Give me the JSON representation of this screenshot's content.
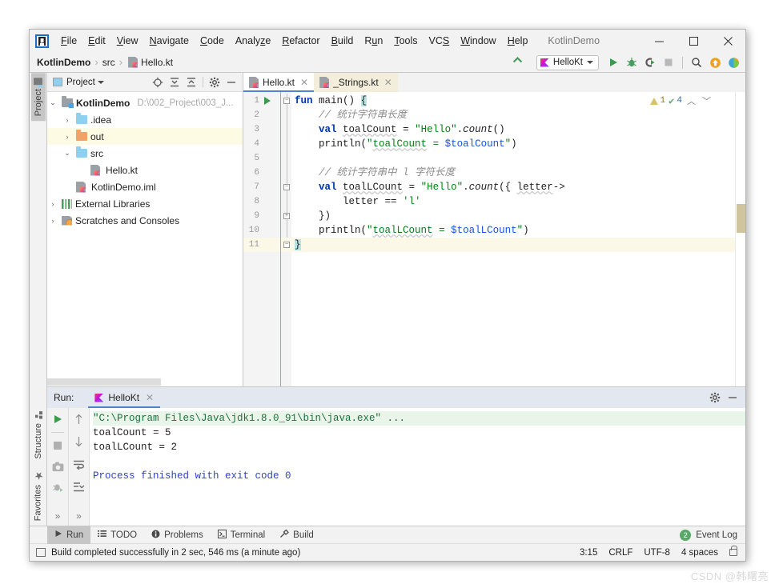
{
  "window": {
    "title": "KotlinDemo",
    "minimize_label": "–",
    "maximize_label": "□",
    "close_label": "✕"
  },
  "menubar": {
    "items": [
      {
        "label": "File",
        "mnemonic": "F"
      },
      {
        "label": "Edit",
        "mnemonic": "E"
      },
      {
        "label": "View",
        "mnemonic": "V"
      },
      {
        "label": "Navigate",
        "mnemonic": "N"
      },
      {
        "label": "Code",
        "mnemonic": "C"
      },
      {
        "label": "Analyze",
        "mnemonic": "z"
      },
      {
        "label": "Refactor",
        "mnemonic": "R"
      },
      {
        "label": "Build",
        "mnemonic": "B"
      },
      {
        "label": "Run",
        "mnemonic": "u"
      },
      {
        "label": "Tools",
        "mnemonic": "T"
      },
      {
        "label": "VCS",
        "mnemonic": "S"
      },
      {
        "label": "Window",
        "mnemonic": "W"
      },
      {
        "label": "Help",
        "mnemonic": "H"
      }
    ]
  },
  "navbar": {
    "breadcrumbs": [
      "KotlinDemo",
      "src",
      "Hello.kt"
    ],
    "separator": "›",
    "run_config": "HelloKt",
    "icons": [
      "back-arrow-icon",
      "run-icon",
      "debug-icon",
      "run-coverage-icon",
      "stop-icon",
      "search-everywhere-icon",
      "update-project-icon",
      "ide-assistant-icon"
    ]
  },
  "rails": {
    "left_top": "Project",
    "left_bottom_1": "Structure",
    "left_bottom_2": "Favorites"
  },
  "project_panel": {
    "title": "Project",
    "toolbar_icons": [
      "locate-icon",
      "expand-all-icon",
      "collapse-all-icon",
      "settings-icon",
      "hide-icon"
    ],
    "tree": [
      {
        "label": "KotlinDemo",
        "path": "D:\\002_Project\\003_J...",
        "icon": "module-folder-icon",
        "indent": 0,
        "arrow": "v",
        "bold": true,
        "highlight": false
      },
      {
        "label": ".idea",
        "path": "",
        "icon": "folder-icon",
        "indent": 1,
        "arrow": ">",
        "bold": false,
        "highlight": false
      },
      {
        "label": "out",
        "path": "",
        "icon": "folder-orange-icon",
        "indent": 1,
        "arrow": ">",
        "bold": false,
        "highlight": true
      },
      {
        "label": "src",
        "path": "",
        "icon": "folder-icon",
        "indent": 1,
        "arrow": "v",
        "bold": false,
        "highlight": false
      },
      {
        "label": "Hello.kt",
        "path": "",
        "icon": "kotlin-file-icon",
        "indent": 2,
        "arrow": "",
        "bold": false,
        "highlight": false
      },
      {
        "label": "KotlinDemo.iml",
        "path": "",
        "icon": "iml-file-icon",
        "indent": 1,
        "arrow": "",
        "bold": false,
        "highlight": false
      },
      {
        "label": "External Libraries",
        "path": "",
        "icon": "libraries-icon",
        "indent": 0,
        "arrow": ">",
        "bold": false,
        "highlight": false
      },
      {
        "label": "Scratches and Consoles",
        "path": "",
        "icon": "scratches-icon",
        "indent": 0,
        "arrow": ">",
        "bold": false,
        "highlight": false
      }
    ]
  },
  "editor": {
    "tabs": [
      {
        "label": "Hello.kt",
        "active": true,
        "library": false,
        "close": "✕"
      },
      {
        "label": "_Strings.kt",
        "active": false,
        "library": true,
        "close": "✕"
      }
    ],
    "inspections": {
      "warning_count": "1",
      "ok_count": "4",
      "prev_label": "︿",
      "next_label": "﹀"
    },
    "line_numbers": [
      "1",
      "2",
      "3",
      "4",
      "5",
      "6",
      "7",
      "8",
      "9",
      "10",
      "11"
    ],
    "current_line": 11,
    "code_lines": [
      {
        "n": 1,
        "text": "fun main() {"
      },
      {
        "n": 2,
        "text": "    // 统计字符串长度"
      },
      {
        "n": 3,
        "text": "    val toalCount = \"Hello\".count()"
      },
      {
        "n": 4,
        "text": "    println(\"toalCount = $toalCount\")"
      },
      {
        "n": 5,
        "text": ""
      },
      {
        "n": 6,
        "text": "    // 统计字符串中 l 字符长度"
      },
      {
        "n": 7,
        "text": "    val toalLCount = \"Hello\".count({ letter->"
      },
      {
        "n": 8,
        "text": "        letter == 'l'"
      },
      {
        "n": 9,
        "text": "    })"
      },
      {
        "n": 10,
        "text": "    println(\"toalLCount = $toalLCount\")"
      },
      {
        "n": 11,
        "text": "}"
      }
    ]
  },
  "run_panel": {
    "label": "Run:",
    "tab": "HelloKt",
    "tab_close": "✕",
    "toolbar_left": [
      "rerun-icon",
      "stop-icon",
      "screenshot-icon",
      "dump-threads-icon",
      "more-icon"
    ],
    "toolbar_right": [
      "up-arrow-icon",
      "down-arrow-icon",
      "soft-wrap-icon",
      "scroll-to-end-icon",
      "more-icon"
    ],
    "header_icons": [
      "settings-icon",
      "hide-icon"
    ],
    "console": [
      {
        "text": "\"C:\\Program Files\\Java\\jdk1.8.0_91\\bin\\java.exe\" ...",
        "style": "cmd"
      },
      {
        "text": "toalCount = 5",
        "style": "out"
      },
      {
        "text": "toalLCount = 2",
        "style": "out"
      },
      {
        "text": "",
        "style": "out"
      },
      {
        "text": "Process finished with exit code 0",
        "style": "end"
      }
    ]
  },
  "toolwindow_bar": {
    "items": [
      {
        "label": "Run",
        "icon": "run-icon",
        "active": true
      },
      {
        "label": "TODO",
        "icon": "todo-icon",
        "active": false
      },
      {
        "label": "Problems",
        "icon": "problems-icon",
        "active": false
      },
      {
        "label": "Terminal",
        "icon": "terminal-icon",
        "active": false
      },
      {
        "label": "Build",
        "icon": "build-icon",
        "active": false
      }
    ],
    "event_log": "Event Log",
    "event_log_count": "2"
  },
  "statusbar": {
    "message": "Build completed successfully in 2 sec, 546 ms (a minute ago)",
    "caret": "3:15",
    "line_sep": "CRLF",
    "encoding": "UTF-8",
    "indent": "4 spaces",
    "lock_icon": "unlocked-icon"
  },
  "watermark": "CSDN @韩曙亮",
  "colors": {
    "accent_blue": "#4a86c8",
    "keyword_blue": "#0033b3",
    "string_green": "#067d17",
    "comment_gray": "#8c8c8c",
    "highlight_yellow": "#fdfbe3",
    "selection_teal": "#b7e3e0"
  }
}
